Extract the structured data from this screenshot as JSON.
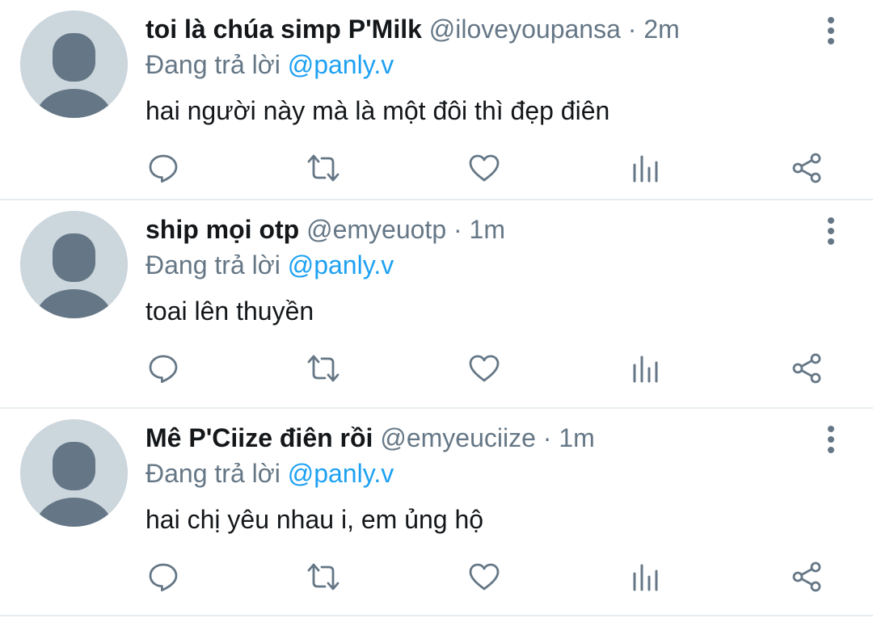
{
  "colors": {
    "name": "#14171a",
    "muted": "#657786",
    "mention": "#1da1f2",
    "avatar_bg": "#ccd6dd",
    "avatar_fg": "#657786",
    "divider": "#e6ecf0"
  },
  "reply_prefix": "Đang trả lời",
  "icons": [
    "reply-icon",
    "retweet-icon",
    "like-icon",
    "analytics-icon",
    "share-icon",
    "more-icon"
  ],
  "replies": [
    {
      "name": "toi là chúa simp P'Milk",
      "handle": "@iloveyoupansa",
      "separator": "·",
      "time": "2m",
      "reply_to": "@panly.v",
      "text": "hai người này mà là một đôi thì đẹp điên"
    },
    {
      "name": "ship mọi otp",
      "handle": "@emyeuotp",
      "separator": "·",
      "time": "1m",
      "reply_to": "@panly.v",
      "text": "toai lên thuyền"
    },
    {
      "name": "Mê P'Ciize điên rồi",
      "handle": "@emyeuciize",
      "separator": "·",
      "time": "1m",
      "reply_to": "@panly.v",
      "text": "hai chị yêu nhau i, em ủng hộ"
    }
  ]
}
